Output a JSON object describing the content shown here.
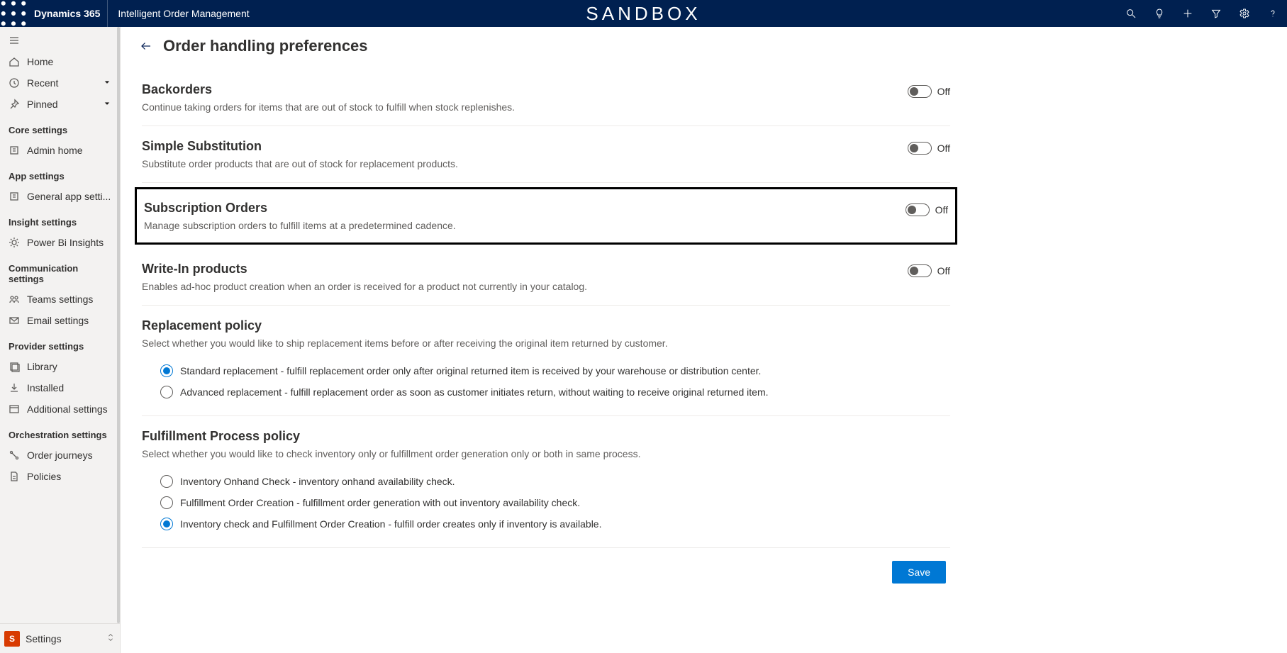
{
  "header": {
    "brand": "Dynamics 365",
    "app": "Intelligent Order Management",
    "env": "SANDBOX"
  },
  "sidebar": {
    "top": {
      "home": "Home",
      "recent": "Recent",
      "pinned": "Pinned"
    },
    "groups": [
      {
        "label": "Core settings",
        "items": [
          "Admin home"
        ]
      },
      {
        "label": "App settings",
        "items": [
          "General app setti..."
        ]
      },
      {
        "label": "Insight settings",
        "items": [
          "Power Bi Insights"
        ]
      },
      {
        "label": "Communication settings",
        "items": [
          "Teams settings",
          "Email settings"
        ]
      },
      {
        "label": "Provider settings",
        "items": [
          "Library",
          "Installed",
          "Additional settings"
        ]
      },
      {
        "label": "Orchestration settings",
        "items": [
          "Order journeys",
          "Policies"
        ]
      }
    ],
    "footer": {
      "badge": "S",
      "label": "Settings"
    }
  },
  "page": {
    "title": "Order handling preferences",
    "save": "Save",
    "toggleOff": "Off",
    "sections": [
      {
        "title": "Backorders",
        "desc": "Continue taking orders for items that are out of stock to fulfill when stock replenishes."
      },
      {
        "title": "Simple Substitution",
        "desc": "Substitute order products that are out of stock for replacement products."
      },
      {
        "title": "Subscription Orders",
        "desc": "Manage subscription orders to fulfill items at a predetermined cadence."
      },
      {
        "title": "Write-In products",
        "desc": "Enables ad-hoc product creation when an order is received for a product not currently in your catalog."
      }
    ],
    "replacement": {
      "title": "Replacement policy",
      "desc": "Select whether you would like to ship replacement items before or after receiving the original item returned by customer.",
      "options": [
        "Standard replacement - fulfill replacement order only after original returned item is received by your warehouse or distribution center.",
        "Advanced replacement - fulfill replacement order as soon as customer initiates return, without waiting to receive original returned item."
      ],
      "selected": 0
    },
    "fulfillment": {
      "title": "Fulfillment Process policy",
      "desc": "Select whether you would like to check inventory only or fulfillment order generation only or both in same process.",
      "options": [
        "Inventory Onhand Check - inventory onhand availability check.",
        "Fulfillment Order Creation - fulfillment order generation with out inventory availability check.",
        "Inventory check and Fulfillment Order Creation - fulfill order creates only if inventory is available."
      ],
      "selected": 2
    }
  }
}
